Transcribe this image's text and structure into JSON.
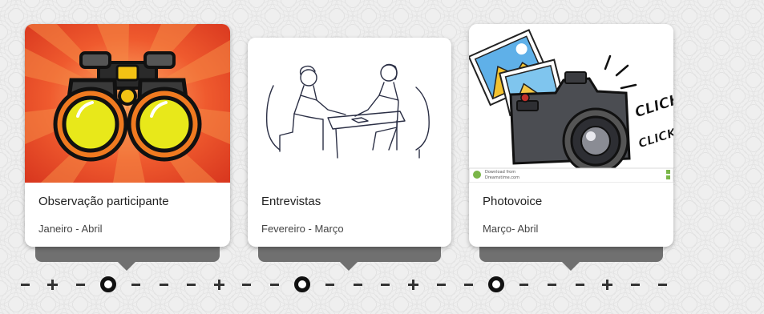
{
  "cards": [
    {
      "title": "Observação participante",
      "date": "Janeiro - Abril",
      "image": "binoculars-image"
    },
    {
      "title": "Entrevistas",
      "date": "Fevereiro - Março",
      "image": "interview-sketch-image"
    },
    {
      "title": "Photovoice",
      "date": "Março- Abril",
      "image": "camera-photos-image",
      "image_text": {
        "click1": "CLICK",
        "click2": "CLICK",
        "credit1": "Download from",
        "credit2": "Dreamstime.com"
      }
    }
  ],
  "timeline": {
    "marks": [
      "dash",
      "plus",
      "dash",
      "dot",
      "dash",
      "dash",
      "dash",
      "plus",
      "dash",
      "dash",
      "dot",
      "dash",
      "dash",
      "dash",
      "plus",
      "dash",
      "dash",
      "dot",
      "dash",
      "dash",
      "dash",
      "plus",
      "dash",
      "dash"
    ]
  },
  "colors": {
    "pointer_bar": "#707070",
    "timeline": "#333333",
    "dot_ring": "#111111",
    "binoculars_bg": "#e8452a"
  }
}
